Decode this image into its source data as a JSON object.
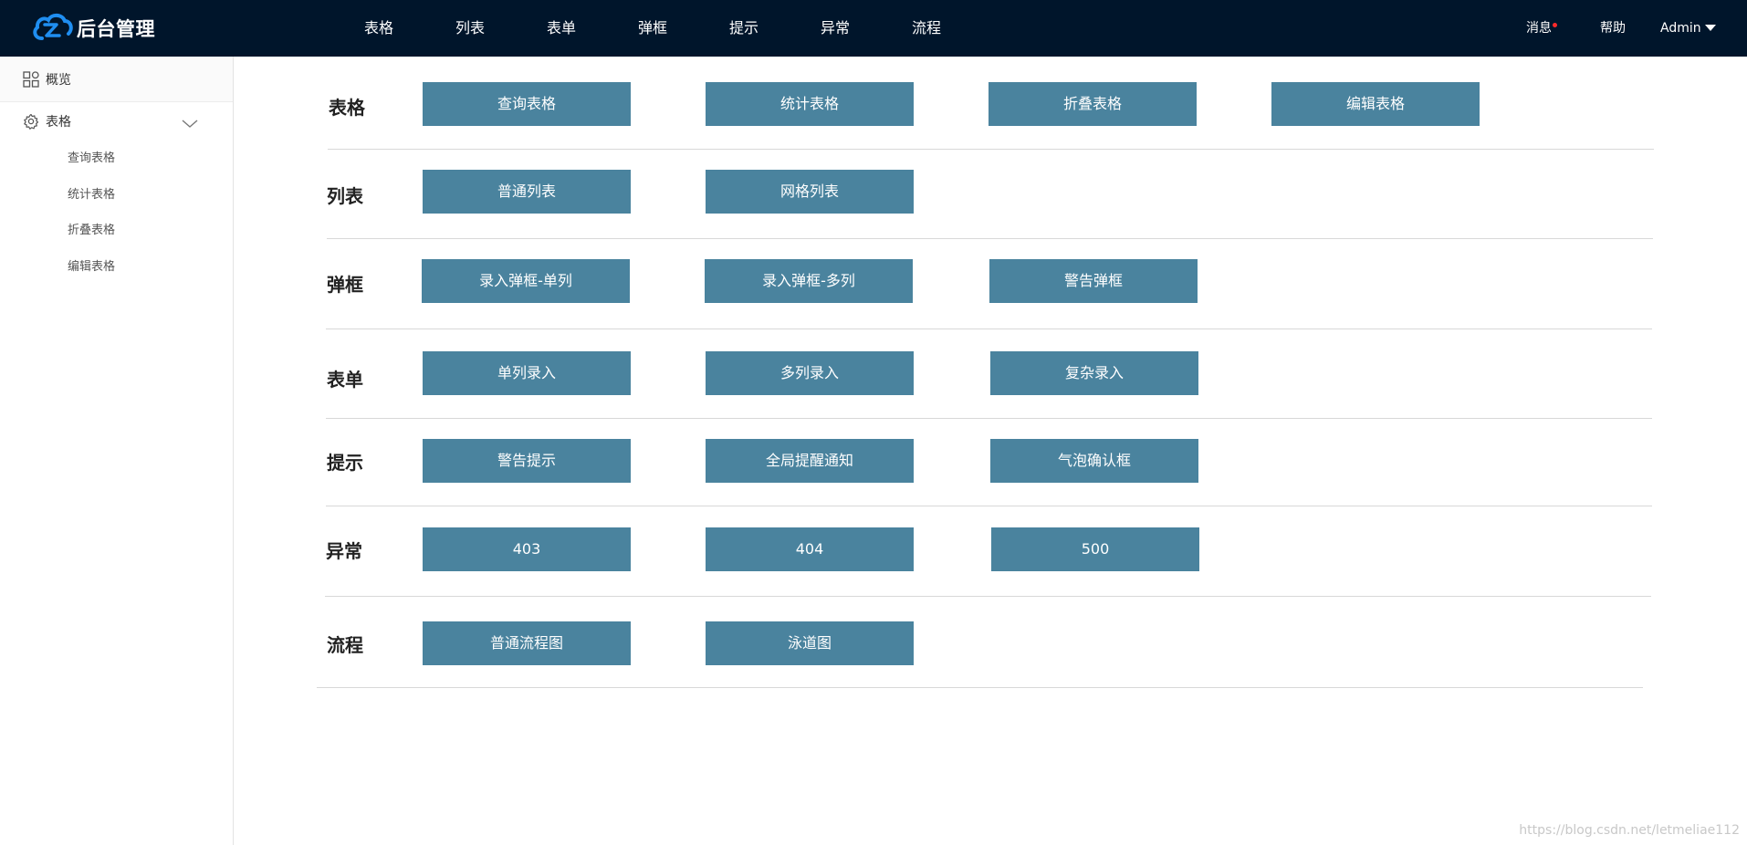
{
  "header": {
    "logo_text": "后台管理",
    "nav": [
      "表格",
      "列表",
      "表单",
      "弹框",
      "提示",
      "异常",
      "流程"
    ],
    "messages_label": "消息",
    "help_label": "帮助",
    "user_label": "Admin",
    "background": "#00152b",
    "logo_color": "#1f8ef1",
    "dot_color": "#ff2a2a"
  },
  "sidebar": {
    "overview_label": "概览",
    "tables_label": "表格",
    "sub_items": [
      "查询表格",
      "统计表格",
      "折叠表格",
      "编辑表格"
    ]
  },
  "main": {
    "button_color": "#4a839e",
    "sections": [
      {
        "title": "表格",
        "buttons": [
          "查询表格",
          "统计表格",
          "折叠表格",
          "编辑表格"
        ]
      },
      {
        "title": "列表",
        "buttons": [
          "普通列表",
          "网格列表"
        ]
      },
      {
        "title": "弹框",
        "buttons": [
          "录入弹框-单列",
          "录入弹框-多列",
          "警告弹框"
        ]
      },
      {
        "title": "表单",
        "buttons": [
          "单列录入",
          "多列录入",
          "复杂录入"
        ]
      },
      {
        "title": "提示",
        "buttons": [
          "警告提示",
          "全局提醒通知",
          "气泡确认框"
        ]
      },
      {
        "title": "异常",
        "buttons": [
          "403",
          "404",
          "500"
        ]
      },
      {
        "title": "流程",
        "buttons": [
          "普通流程图",
          "泳道图"
        ]
      }
    ]
  },
  "watermark": "https://blog.csdn.net/letmeliae112"
}
